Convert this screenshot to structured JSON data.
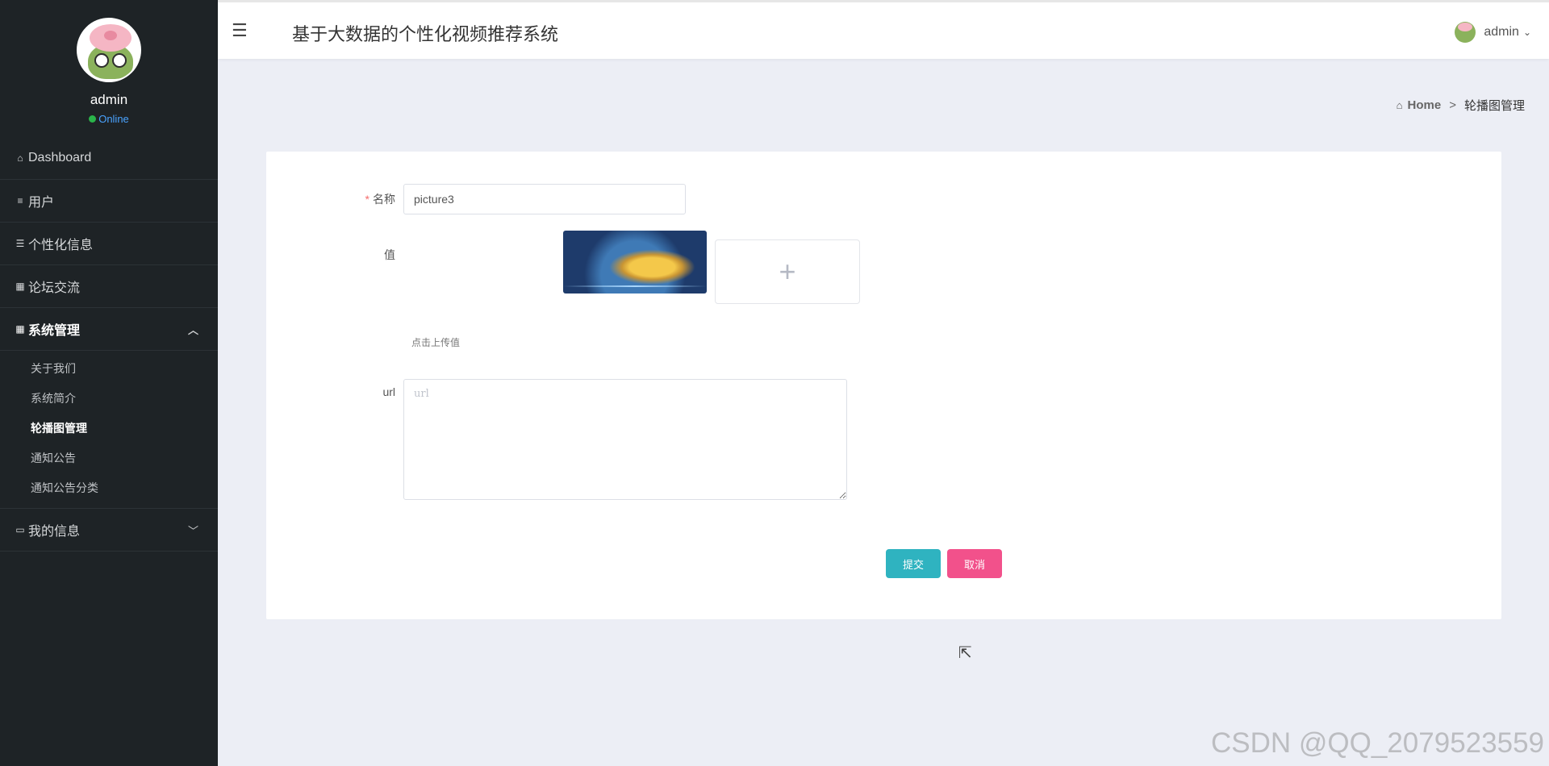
{
  "app": {
    "title": "基于大数据的个性化视频推荐系统"
  },
  "profile": {
    "name": "admin",
    "status": "Online"
  },
  "sidebar": {
    "items": [
      {
        "label": "Dashboard",
        "icon": "home-icon"
      },
      {
        "label": "用户",
        "icon": "sliders-icon"
      },
      {
        "label": "个性化信息",
        "icon": "list-icon"
      },
      {
        "label": "论坛交流",
        "icon": "grid-icon"
      },
      {
        "label": "系统管理",
        "icon": "grid-icon",
        "expanded": true
      },
      {
        "label": "我的信息",
        "icon": "card-icon"
      }
    ],
    "sub_items": [
      {
        "label": "关于我们"
      },
      {
        "label": "系统简介"
      },
      {
        "label": "轮播图管理",
        "active": true
      },
      {
        "label": "通知公告"
      },
      {
        "label": "通知公告分类"
      }
    ]
  },
  "header": {
    "user": "admin"
  },
  "breadcrumb": {
    "home": "Home",
    "separator": ">",
    "current": "轮播图管理"
  },
  "form": {
    "name_label": "名称",
    "name_value": "picture3",
    "value_label": "值",
    "upload_hint": "点击上传值",
    "url_label": "url",
    "url_placeholder": "url",
    "submit_label": "提交",
    "cancel_label": "取消"
  },
  "colors": {
    "sidebar_bg": "#1e2326",
    "submit": "#2fb3c0",
    "cancel": "#f2518b",
    "online": "#2ab44a",
    "required": "#f56c6c"
  },
  "watermark": "CSDN @QQ_2079523559"
}
